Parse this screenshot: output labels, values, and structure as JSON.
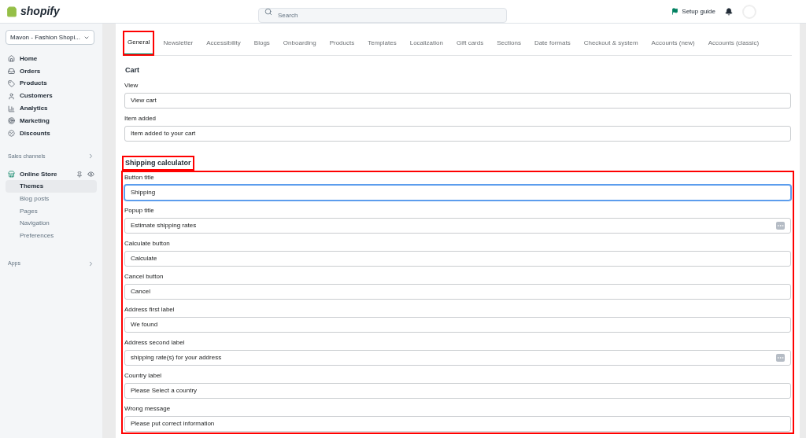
{
  "topbar": {
    "logo": "shopify",
    "search": {
      "placeholder": "Search"
    },
    "setup_guide": "Setup guide"
  },
  "sidebar": {
    "store": "Mavon - Fashion Shopi...",
    "items": [
      {
        "label": "Home"
      },
      {
        "label": "Orders"
      },
      {
        "label": "Products"
      },
      {
        "label": "Customers"
      },
      {
        "label": "Analytics"
      },
      {
        "label": "Marketing"
      },
      {
        "label": "Discounts"
      }
    ],
    "sales_channels": "Sales channels",
    "channel": {
      "label": "Online Store",
      "children": [
        {
          "label": "Themes",
          "selected": true
        },
        {
          "label": "Blog posts",
          "selected": false
        },
        {
          "label": "Pages",
          "selected": false
        },
        {
          "label": "Navigation",
          "selected": false
        },
        {
          "label": "Preferences",
          "selected": false
        }
      ]
    },
    "apps": "Apps"
  },
  "tabs": [
    {
      "label": "General",
      "selected": true,
      "highlighted": true
    },
    {
      "label": "Newsletter",
      "selected": false,
      "highlighted": false
    },
    {
      "label": "Accessibility",
      "selected": false,
      "highlighted": false
    },
    {
      "label": "Blogs",
      "selected": false,
      "highlighted": false
    },
    {
      "label": "Onboarding",
      "selected": false,
      "highlighted": false
    },
    {
      "label": "Products",
      "selected": false,
      "highlighted": false
    },
    {
      "label": "Templates",
      "selected": false,
      "highlighted": false
    },
    {
      "label": "Localization",
      "selected": false,
      "highlighted": false
    },
    {
      "label": "Gift cards",
      "selected": false,
      "highlighted": false
    },
    {
      "label": "Sections",
      "selected": false,
      "highlighted": false
    },
    {
      "label": "Date formats",
      "selected": false,
      "highlighted": false
    },
    {
      "label": "Checkout & system",
      "selected": false,
      "highlighted": false
    },
    {
      "label": "Accounts (new)",
      "selected": false,
      "highlighted": false
    },
    {
      "label": "Accounts (classic)",
      "selected": false,
      "highlighted": false
    }
  ],
  "sections": [
    {
      "title": "Cart",
      "highlighted": false,
      "fields": [
        {
          "label": "View",
          "value": "View cart",
          "focused": false,
          "has_icon": false
        },
        {
          "label": "Item added",
          "value": "Item added to your cart",
          "focused": false,
          "has_icon": false
        }
      ]
    },
    {
      "title": "Shipping calculator",
      "highlighted": true,
      "fields": [
        {
          "label": "Button title",
          "value": "Shipping",
          "focused": true,
          "has_icon": false
        },
        {
          "label": "Popup title",
          "value": "Estimate shipping rates",
          "focused": false,
          "has_icon": true
        },
        {
          "label": "Calculate button",
          "value": "Calculate",
          "focused": false,
          "has_icon": false
        },
        {
          "label": "Cancel button",
          "value": "Cancel",
          "focused": false,
          "has_icon": false
        },
        {
          "label": "Address first label",
          "value": "We found",
          "focused": false,
          "has_icon": false
        },
        {
          "label": "Address second label",
          "value": "shipping rate(s) for your address",
          "focused": false,
          "has_icon": true
        },
        {
          "label": "Country label",
          "value": "Please Select a country",
          "focused": false,
          "has_icon": false
        },
        {
          "label": "Wrong message",
          "value": "Please put correct information",
          "focused": false,
          "has_icon": false
        }
      ]
    }
  ]
}
